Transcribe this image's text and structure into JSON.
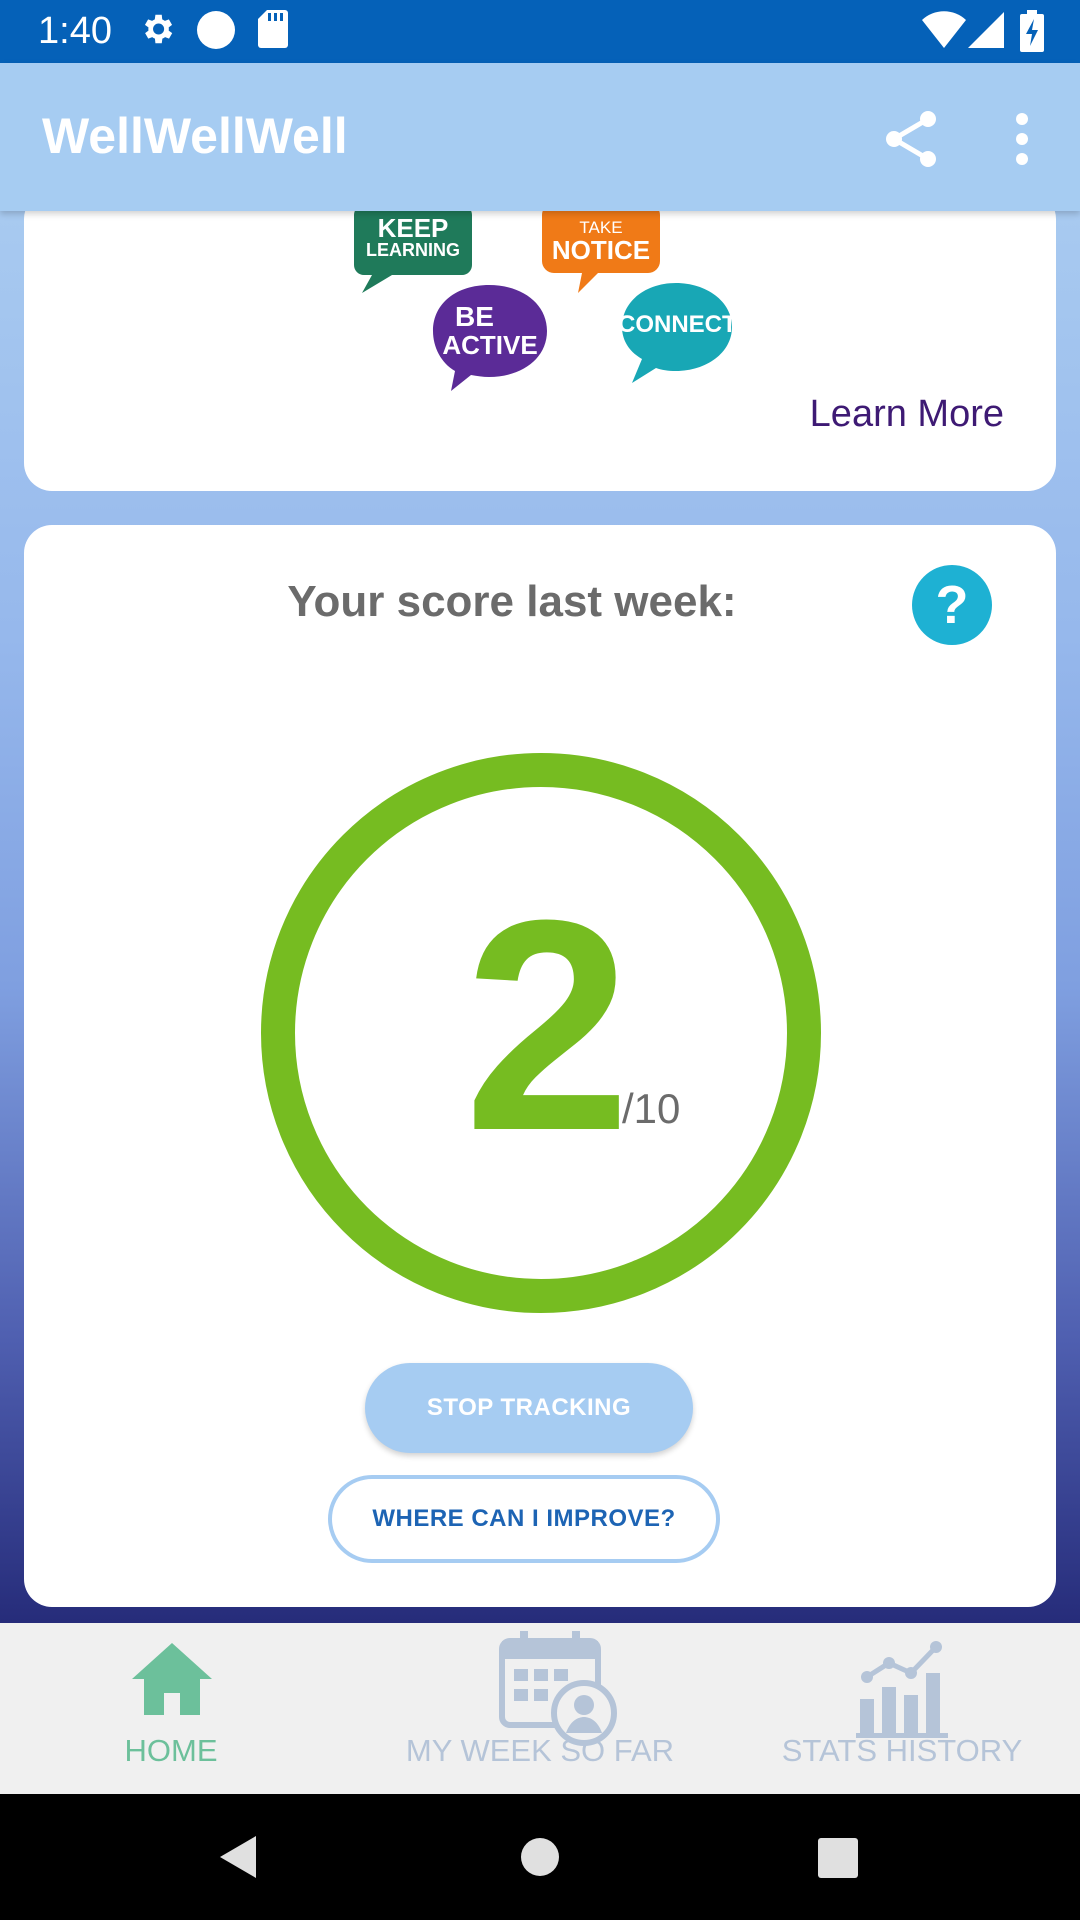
{
  "status_bar": {
    "time": "1:40"
  },
  "app_bar": {
    "title": "WellWellWell"
  },
  "banner": {
    "bubbles": [
      {
        "line1": "KEEP",
        "line2": "LEARNING",
        "color": "#1f7a5a"
      },
      {
        "line1": "TAKE",
        "line2": "NOTICE",
        "color": "#f07a17"
      },
      {
        "line1": "BE",
        "line2": "ACTIVE",
        "color": "#5b2b97"
      },
      {
        "line1": "CONNECT",
        "line2": "",
        "color": "#18a7b5"
      }
    ],
    "learn_more": "Learn More"
  },
  "score_card": {
    "heading": "Your score last week:",
    "score": "2",
    "out_of": "/10",
    "ring_color": "#76bc21",
    "stop_button": "STOP TRACKING",
    "improve_button": "WHERE CAN I IMPROVE?"
  },
  "bottom_nav": {
    "items": [
      {
        "label": "HOME",
        "icon": "home-icon",
        "active": true
      },
      {
        "label": "MY WEEK SO FAR",
        "icon": "calendar-person-icon",
        "active": false
      },
      {
        "label": "STATS HISTORY",
        "icon": "stats-chart-icon",
        "active": false
      }
    ]
  },
  "colors": {
    "status_bar": "#0561b8",
    "app_bar": "#a6ccf2",
    "accent_green": "#76bc21",
    "help_teal": "#1eb1d3",
    "nav_active": "#6cc09b",
    "nav_inactive": "#b5c4d8"
  }
}
